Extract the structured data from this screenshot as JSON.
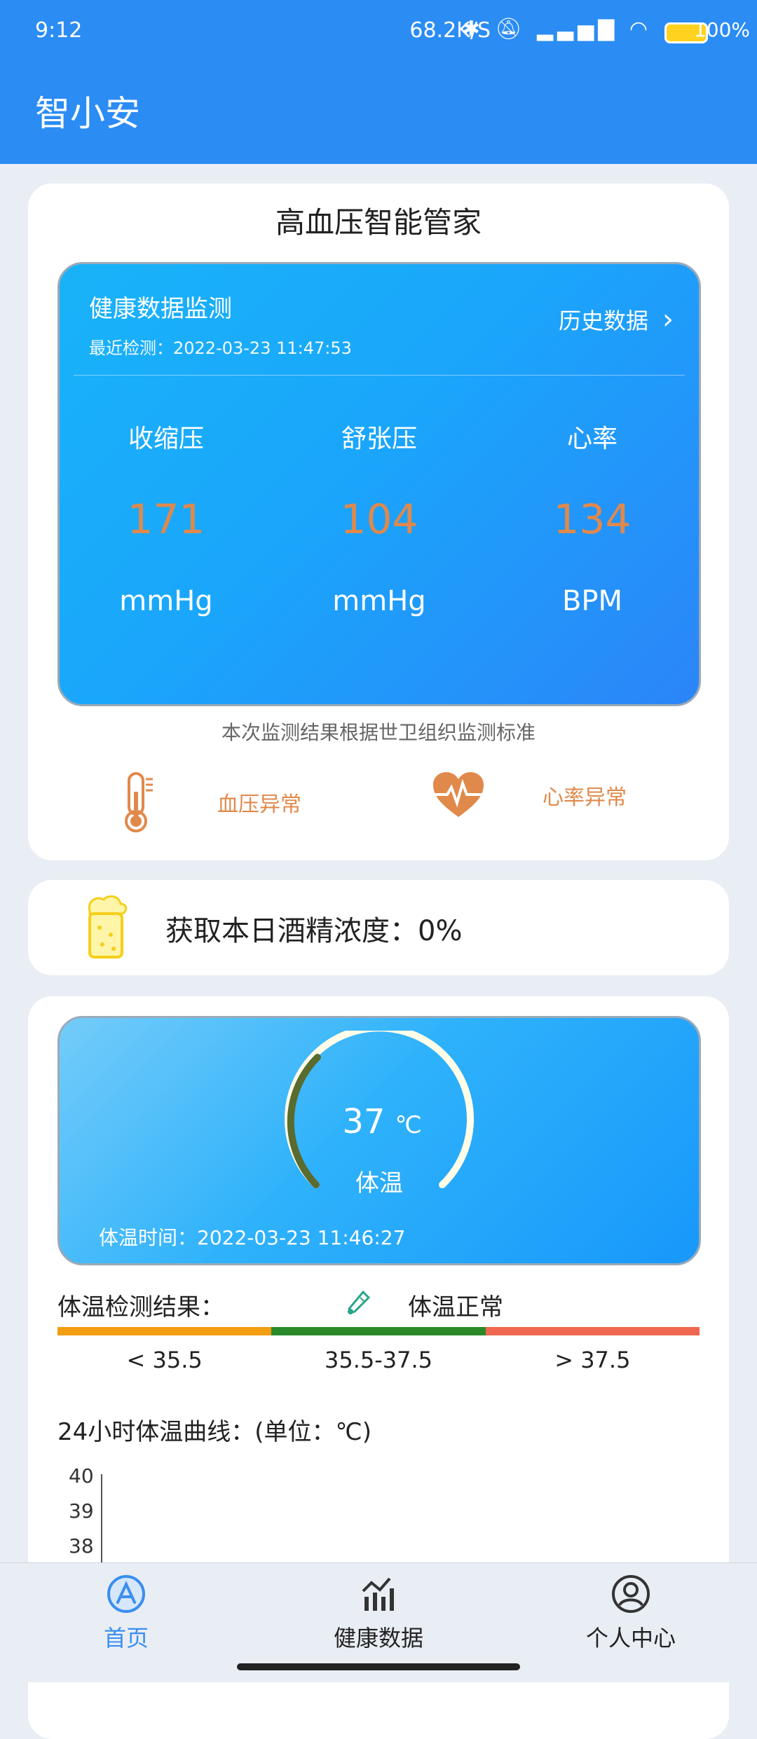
{
  "status_bar": {
    "time": "9:12",
    "net_speed": "68.2K/S",
    "icons": [
      "bluetooth-icon",
      "mute-icon",
      "hd-signal-icon",
      "wifi-icon"
    ],
    "battery": "100%"
  },
  "app_bar": {
    "title": "智小安"
  },
  "bp_card": {
    "heading": "高血压智能管家",
    "monitor": {
      "title": "健康数据监测",
      "recent": "最近检测：2022-03-23 11:47:53",
      "history_label": "历史数据",
      "metrics": [
        {
          "label": "收缩压",
          "value": "171",
          "unit": "mmHg"
        },
        {
          "label": "舒张压",
          "value": "104",
          "unit": "mmHg"
        },
        {
          "label": "心率",
          "value": "134",
          "unit": "BPM"
        }
      ]
    },
    "standard_note": "本次监测结果根据世卫组织监测标准",
    "alerts": [
      {
        "icon": "thermometer-icon",
        "text": "血压异常"
      },
      {
        "icon": "heart-pulse-icon",
        "text": "心率异常"
      }
    ]
  },
  "alcohol_card": {
    "icon": "beer-icon",
    "text": "获取本日酒精浓度：0%"
  },
  "temp_card": {
    "value": "37",
    "unit": "℃",
    "label": "体温",
    "time": "体温时间：2022-03-23 11:46:27",
    "result_label": "体温检测结果：",
    "result_value": "体温正常",
    "ranges": [
      "< 35.5",
      "35.5-37.5",
      "> 37.5"
    ],
    "range_colors": [
      "#f29d12",
      "#2a8a2a",
      "#f0674f"
    ],
    "curve_label": "24小时体温曲线：(单位：℃)",
    "y_ticks": [
      "40",
      "39",
      "38"
    ]
  },
  "bottom_nav": [
    {
      "icon": "home-icon",
      "label": "首页",
      "active": true
    },
    {
      "icon": "chart-icon",
      "label": "健康数据",
      "active": false
    },
    {
      "icon": "user-icon",
      "label": "个人中心",
      "active": false
    }
  ],
  "colors": {
    "primary": "#2b8cf4",
    "accent": "#e0894b",
    "active_nav": "#3a8ef0"
  }
}
